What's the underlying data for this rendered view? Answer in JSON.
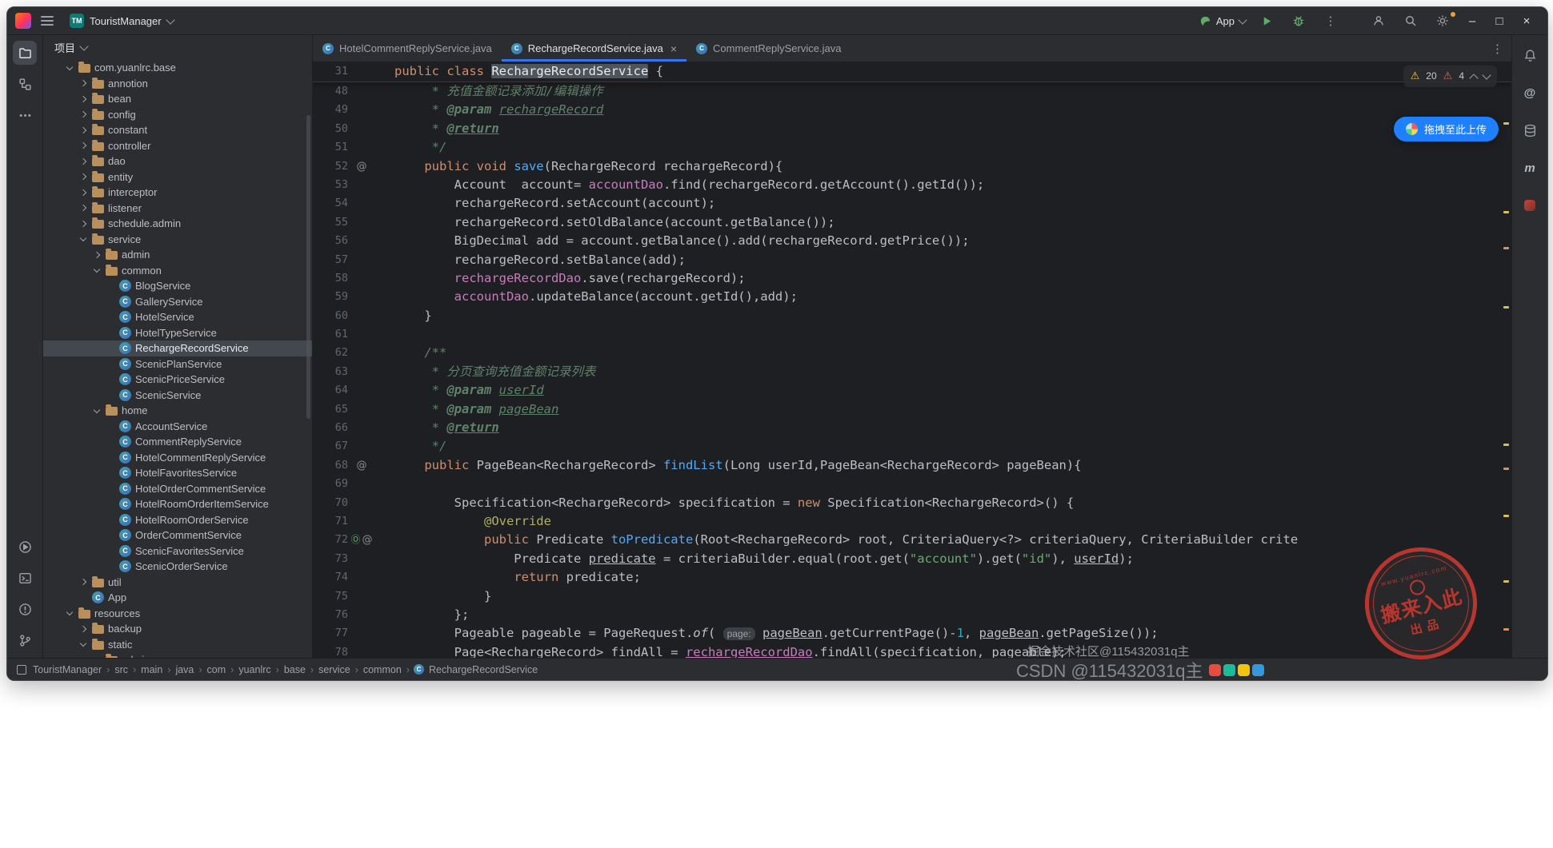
{
  "colors": {
    "accent": "#3574f0",
    "run_green": "#5fad65",
    "upload_blue": "#1e80ff",
    "stamp_red": "#cf3a30",
    "warning_yellow": "#f2c55c"
  },
  "titlebar": {
    "project_badge": "TM",
    "project_name": "TouristManager",
    "run_config": "App",
    "window_controls": {
      "minimize": "–",
      "maximize": "□",
      "close": "×"
    }
  },
  "project_panel": {
    "title": "项目"
  },
  "tree": [
    {
      "label": "com.yuanlrc.base",
      "indent": 1,
      "icon": "package",
      "chev": "open",
      "selected": false
    },
    {
      "label": "annotion",
      "indent": 2,
      "icon": "package",
      "chev": "closed",
      "selected": false
    },
    {
      "label": "bean",
      "indent": 2,
      "icon": "package",
      "chev": "closed",
      "selected": false
    },
    {
      "label": "config",
      "indent": 2,
      "icon": "package",
      "chev": "closed",
      "selected": false
    },
    {
      "label": "constant",
      "indent": 2,
      "icon": "package",
      "chev": "closed",
      "selected": false
    },
    {
      "label": "controller",
      "indent": 2,
      "icon": "package",
      "chev": "closed",
      "selected": false
    },
    {
      "label": "dao",
      "indent": 2,
      "icon": "package",
      "chev": "closed",
      "selected": false
    },
    {
      "label": "entity",
      "indent": 2,
      "icon": "package",
      "chev": "closed",
      "selected": false
    },
    {
      "label": "interceptor",
      "indent": 2,
      "icon": "package",
      "chev": "closed",
      "selected": false
    },
    {
      "label": "listener",
      "indent": 2,
      "icon": "package",
      "chev": "closed",
      "selected": false
    },
    {
      "label": "schedule.admin",
      "indent": 2,
      "icon": "package",
      "chev": "closed",
      "selected": false
    },
    {
      "label": "service",
      "indent": 2,
      "icon": "package",
      "chev": "open",
      "selected": false
    },
    {
      "label": "admin",
      "indent": 3,
      "icon": "package",
      "chev": "closed",
      "selected": false
    },
    {
      "label": "common",
      "indent": 3,
      "icon": "package",
      "chev": "open",
      "selected": false
    },
    {
      "label": "BlogService",
      "indent": 4,
      "icon": "class",
      "chev": "none",
      "selected": false
    },
    {
      "label": "GalleryService",
      "indent": 4,
      "icon": "class",
      "chev": "none",
      "selected": false
    },
    {
      "label": "HotelService",
      "indent": 4,
      "icon": "class",
      "chev": "none",
      "selected": false
    },
    {
      "label": "HotelTypeService",
      "indent": 4,
      "icon": "class",
      "chev": "none",
      "selected": false
    },
    {
      "label": "RechargeRecordService",
      "indent": 4,
      "icon": "class",
      "chev": "none",
      "selected": true
    },
    {
      "label": "ScenicPlanService",
      "indent": 4,
      "icon": "class",
      "chev": "none",
      "selected": false
    },
    {
      "label": "ScenicPriceService",
      "indent": 4,
      "icon": "class",
      "chev": "none",
      "selected": false
    },
    {
      "label": "ScenicService",
      "indent": 4,
      "icon": "class",
      "chev": "none",
      "selected": false
    },
    {
      "label": "home",
      "indent": 3,
      "icon": "package",
      "chev": "open",
      "selected": false
    },
    {
      "label": "AccountService",
      "indent": 4,
      "icon": "class",
      "chev": "none",
      "selected": false
    },
    {
      "label": "CommentReplyService",
      "indent": 4,
      "icon": "class",
      "chev": "none",
      "selected": false
    },
    {
      "label": "HotelCommentReplyService",
      "indent": 4,
      "icon": "class",
      "chev": "none",
      "selected": false
    },
    {
      "label": "HotelFavoritesService",
      "indent": 4,
      "icon": "class",
      "chev": "none",
      "selected": false
    },
    {
      "label": "HotelOrderCommentService",
      "indent": 4,
      "icon": "class",
      "chev": "none",
      "selected": false
    },
    {
      "label": "HotelRoomOrderItemService",
      "indent": 4,
      "icon": "class",
      "chev": "none",
      "selected": false
    },
    {
      "label": "HotelRoomOrderService",
      "indent": 4,
      "icon": "class",
      "chev": "none",
      "selected": false
    },
    {
      "label": "OrderCommentService",
      "indent": 4,
      "icon": "class",
      "chev": "none",
      "selected": false
    },
    {
      "label": "ScenicFavoritesService",
      "indent": 4,
      "icon": "class",
      "chev": "none",
      "selected": false
    },
    {
      "label": "ScenicOrderService",
      "indent": 4,
      "icon": "class",
      "chev": "none",
      "selected": false
    },
    {
      "label": "util",
      "indent": 2,
      "icon": "package",
      "chev": "closed",
      "selected": false
    },
    {
      "label": "App",
      "indent": 2,
      "icon": "class",
      "chev": "none",
      "selected": false
    },
    {
      "label": "resources",
      "indent": 1,
      "icon": "folder",
      "chev": "open",
      "selected": false
    },
    {
      "label": "backup",
      "indent": 2,
      "icon": "folder",
      "chev": "closed",
      "selected": false
    },
    {
      "label": "static",
      "indent": 2,
      "icon": "folder",
      "chev": "open",
      "selected": false
    },
    {
      "label": "admin",
      "indent": 3,
      "icon": "folder",
      "chev": "open",
      "selected": false
    }
  ],
  "tabs": [
    {
      "label": "HotelCommentReplyService.java",
      "active": false
    },
    {
      "label": "RechargeRecordService.java",
      "active": true,
      "close_glyph": "×"
    },
    {
      "label": "CommentReplyService.java",
      "active": false
    }
  ],
  "editor": {
    "sticky": {
      "n": "31",
      "t": [
        [
          "public class ",
          "kw"
        ],
        [
          "RechargeRecordService",
          "def hlbox"
        ],
        [
          " {",
          "def"
        ]
      ]
    },
    "inspections": {
      "warnings": "20",
      "errors": "4"
    },
    "scroll_marks": [
      10,
      25,
      31,
      41,
      64,
      68,
      76,
      87,
      95
    ],
    "lines": [
      {
        "n": "48",
        "g": "",
        "t": [
          [
            "     * 充值金额记录添加/编辑操作",
            "doc"
          ]
        ]
      },
      {
        "n": "49",
        "g": "",
        "t": [
          [
            "     * ",
            "doc"
          ],
          [
            "@param ",
            "doctag"
          ],
          [
            "rechargeRecord",
            "docparam"
          ]
        ]
      },
      {
        "n": "50",
        "g": "",
        "t": [
          [
            "     * ",
            "doc"
          ],
          [
            "@return",
            "doctag uline"
          ]
        ]
      },
      {
        "n": "51",
        "g": "",
        "t": [
          [
            "     */",
            "doc"
          ]
        ]
      },
      {
        "n": "52",
        "g": "a",
        "t": [
          [
            "    ",
            "def"
          ],
          [
            "public void ",
            "kw"
          ],
          [
            "save",
            "mdecl"
          ],
          [
            "(RechargeRecord rechargeRecord){",
            "def"
          ]
        ]
      },
      {
        "n": "53",
        "g": "",
        "t": [
          [
            "        Account  account= ",
            "def"
          ],
          [
            "accountDao",
            "field"
          ],
          [
            ".find(rechargeRecord.getAccount().getId());",
            "def"
          ]
        ]
      },
      {
        "n": "54",
        "g": "",
        "t": [
          [
            "        rechargeRecord.setAccount(account);",
            "def"
          ]
        ]
      },
      {
        "n": "55",
        "g": "",
        "t": [
          [
            "        rechargeRecord.setOldBalance(account.getBalance());",
            "def"
          ]
        ]
      },
      {
        "n": "56",
        "g": "",
        "t": [
          [
            "        BigDecimal add = account.getBalance().add(rechargeRecord.getPrice());",
            "def"
          ]
        ]
      },
      {
        "n": "57",
        "g": "",
        "t": [
          [
            "        rechargeRecord.setBalance(add);",
            "def"
          ]
        ]
      },
      {
        "n": "58",
        "g": "",
        "t": [
          [
            "        ",
            "def"
          ],
          [
            "rechargeRecordDao",
            "field"
          ],
          [
            ".save(rechargeRecord);",
            "def"
          ]
        ]
      },
      {
        "n": "59",
        "g": "",
        "t": [
          [
            "        ",
            "def"
          ],
          [
            "accountDao",
            "field"
          ],
          [
            ".updateBalance(account.getId(),add);",
            "def"
          ]
        ]
      },
      {
        "n": "60",
        "g": "",
        "t": [
          [
            "    }",
            "def"
          ]
        ]
      },
      {
        "n": "61",
        "g": "",
        "t": []
      },
      {
        "n": "62",
        "g": "",
        "t": [
          [
            "    /**",
            "doc"
          ]
        ]
      },
      {
        "n": "63",
        "g": "",
        "t": [
          [
            "     * 分页查询充值金额记录列表",
            "doc"
          ]
        ]
      },
      {
        "n": "64",
        "g": "",
        "t": [
          [
            "     * ",
            "doc"
          ],
          [
            "@param ",
            "doctag"
          ],
          [
            "userId",
            "docparam"
          ]
        ]
      },
      {
        "n": "65",
        "g": "",
        "t": [
          [
            "     * ",
            "doc"
          ],
          [
            "@param ",
            "doctag"
          ],
          [
            "pageBean",
            "docparam"
          ]
        ]
      },
      {
        "n": "66",
        "g": "",
        "t": [
          [
            "     * ",
            "doc"
          ],
          [
            "@return",
            "doctag uline"
          ]
        ]
      },
      {
        "n": "67",
        "g": "",
        "t": [
          [
            "     */",
            "doc"
          ]
        ]
      },
      {
        "n": "68",
        "g": "a",
        "t": [
          [
            "    ",
            "def"
          ],
          [
            "public ",
            "kw"
          ],
          [
            "PageBean<RechargeRecord> ",
            "def"
          ],
          [
            "findList",
            "mdecl"
          ],
          [
            "(Long userId,PageBean<RechargeRecord> pageBean){",
            "def"
          ]
        ]
      },
      {
        "n": "69",
        "g": "",
        "t": []
      },
      {
        "n": "70",
        "g": "",
        "t": [
          [
            "        Specification<RechargeRecord> specification = ",
            "def"
          ],
          [
            "new ",
            "kw"
          ],
          [
            "Specification<RechargeRecord>() {",
            "def"
          ]
        ]
      },
      {
        "n": "71",
        "g": "",
        "t": [
          [
            "            ",
            "def"
          ],
          [
            "@Override",
            "ann"
          ]
        ]
      },
      {
        "n": "72",
        "g": "oa",
        "t": [
          [
            "            ",
            "def"
          ],
          [
            "public ",
            "kw"
          ],
          [
            "Predicate ",
            "def"
          ],
          [
            "toPredicate",
            "mdecl"
          ],
          [
            "(Root<RechargeRecord> root, CriteriaQuery<?> criteriaQuery, CriteriaBuilder crite",
            "def"
          ]
        ]
      },
      {
        "n": "73",
        "g": "",
        "t": [
          [
            "                Predicate ",
            "def"
          ],
          [
            "predicate",
            "def uline"
          ],
          [
            " = criteriaBuilder.equal(root.get(",
            "def"
          ],
          [
            "\"account\"",
            "str"
          ],
          [
            ").get(",
            "def"
          ],
          [
            "\"id\"",
            "str"
          ],
          [
            "), ",
            "def"
          ],
          [
            "userId",
            "def uline"
          ],
          [
            ");",
            "def"
          ]
        ]
      },
      {
        "n": "74",
        "g": "",
        "t": [
          [
            "                ",
            "def"
          ],
          [
            "return",
            "kw"
          ],
          [
            " predicate;",
            "def"
          ]
        ]
      },
      {
        "n": "75",
        "g": "",
        "t": [
          [
            "            }",
            "def"
          ]
        ]
      },
      {
        "n": "76",
        "g": "",
        "t": [
          [
            "        };",
            "def"
          ]
        ]
      },
      {
        "n": "77",
        "g": "",
        "t": [
          [
            "        Pageable pageable = PageRequest.",
            "def"
          ],
          [
            "of",
            "def italic"
          ],
          [
            "( ",
            "def"
          ],
          [
            "page:",
            "hint"
          ],
          [
            " ",
            "def"
          ],
          [
            "pageBean",
            "def uline"
          ],
          [
            ".getCurrentPage()-",
            "def"
          ],
          [
            "1",
            "num"
          ],
          [
            ", ",
            "def"
          ],
          [
            "pageBean",
            "def uline"
          ],
          [
            ".getPageSize());",
            "def"
          ]
        ]
      },
      {
        "n": "78",
        "g": "",
        "t": [
          [
            "        Page<RechargeRecord> findAll = ",
            "def"
          ],
          [
            "rechargeRecordDao",
            "field uline"
          ],
          [
            ".findAll(specification, pageable);",
            "def"
          ]
        ]
      }
    ]
  },
  "breadcrumbs": [
    "TouristManager",
    "src",
    "main",
    "java",
    "com",
    "yuanlrc",
    "base",
    "service",
    "common",
    "RechargeRecordService"
  ],
  "breadcrumb_separator": "›",
  "right_strip": {
    "maven_label": "m",
    "ai_label": "@"
  },
  "overlay": {
    "upload_label": "拖拽至此上传",
    "stamp_site": "www.yuanlrc.com",
    "stamp_main": "搬来入此",
    "stamp_sub": "出品",
    "watermark_small": "掘金技术社区@115432031q主",
    "watermark_large": "CSDN @115432031q主"
  }
}
